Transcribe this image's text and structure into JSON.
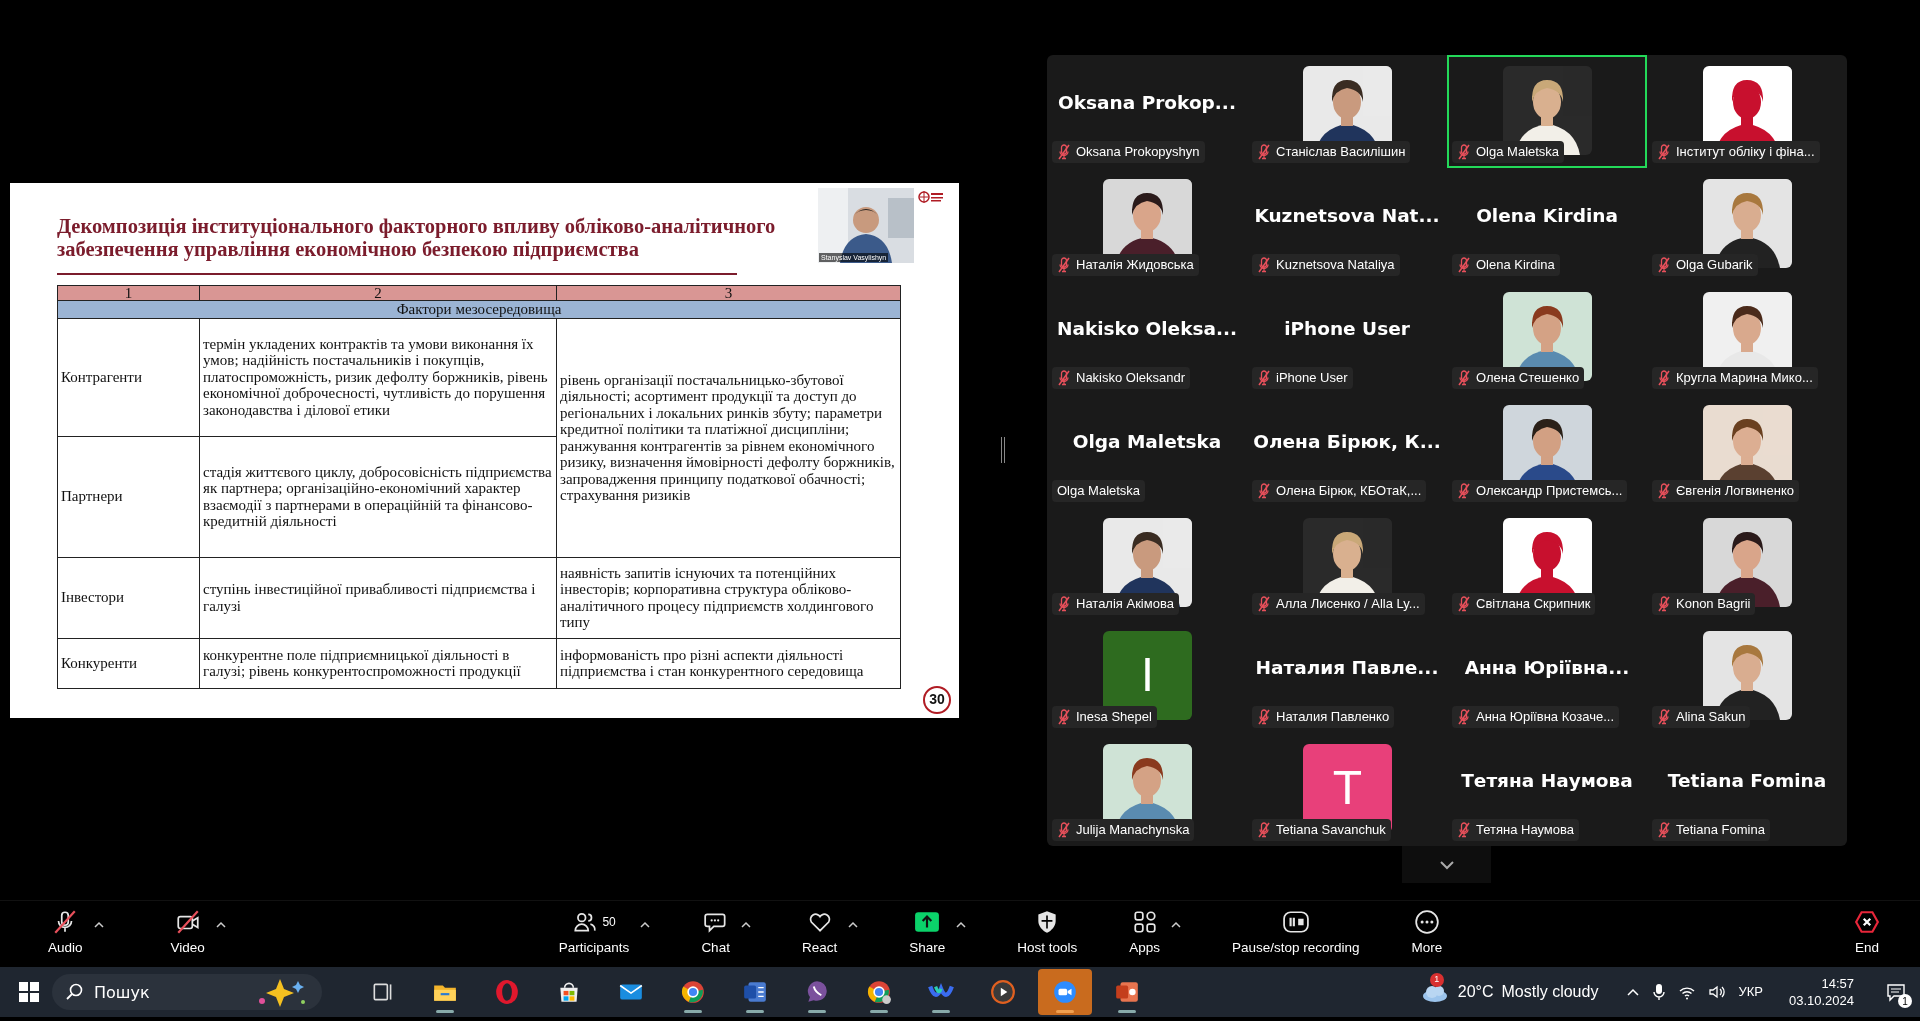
{
  "slide": {
    "title_lines": [
      "Декомпозиція інституціонального факторного впливу обліково-аналітичного",
      "забезпечення управління економічною безпекою підприємства"
    ],
    "presenter_video": {
      "name": "Stanyslav Vasylishyn"
    },
    "columns": [
      "1",
      "2",
      "3"
    ],
    "section": "Фактори мезосередовища",
    "groups": [
      {
        "indicators": "рівень організації постачальницько-збутової діяльності; асортимент продукції та доступ до регіональних і локальних ринків збуту; параметри кредитної політики та платіжної дисципліни; ранжування контрагентів за рівнем економічного ризику, визначення ймовірності дефолту боржників, запровадження принципу податкової обачності; страхування ризиків",
        "rows": [
          {
            "factor": "Контрагенти",
            "description": "термін укладених контрактів та умови виконання їх умов; надійність постачальників і покупців, платоспроможність, ризик дефолту боржників, рівень економічної доброчесності, чутливість до порушення законодавства і ділової етики"
          },
          {
            "factor": "Партнери",
            "description": "стадія життєвого циклу, добросовісність підприємства як партнера; організаційно-економічний характер взаємодії з партнерами в операційній та фінансово-кредитній діяльності"
          }
        ]
      },
      {
        "indicators": "наявність запитів існуючих та потенційних інвесторів; корпоративна структура обліково-аналітичного процесу підприємств холдингового типу",
        "rows": [
          {
            "factor": "Інвестори",
            "description": "ступінь інвестиційної привабливості підприємства і галузі"
          }
        ]
      },
      {
        "indicators": "інформованість про різні аспекти діяльності підприємства і стан конкурентного середовища",
        "rows": [
          {
            "factor": "Конкуренти",
            "description": "конкурентне поле підприємницької діяльності в галузі; рівень конкурентоспроможності продукції"
          }
        ]
      }
    ],
    "page_number": "30"
  },
  "gallery": {
    "tiles": [
      {
        "kind": "name",
        "display_name": "Oksana  Prokop...",
        "label": "Oksana Prokopyshyn",
        "muted": true,
        "speaking": false
      },
      {
        "kind": "picture",
        "label": "Станіслав Василішин",
        "muted": true,
        "speaking": false
      },
      {
        "kind": "picture",
        "label": "Olga Maletska",
        "muted": true,
        "speaking": true
      },
      {
        "kind": "picture",
        "label": "Інститут обліку і фіна...",
        "muted": true,
        "speaking": false
      },
      {
        "kind": "picture",
        "label": "Наталія Жидовська",
        "muted": true,
        "speaking": false
      },
      {
        "kind": "name",
        "display_name": "Kuznetsova  Nat...",
        "label": "Kuznetsova Nataliya",
        "muted": true,
        "speaking": false
      },
      {
        "kind": "name",
        "display_name": "Olena Kirdina",
        "label": "Olena Kirdina",
        "muted": true,
        "speaking": false
      },
      {
        "kind": "picture",
        "label": "Olga Gubarik",
        "muted": true,
        "speaking": false
      },
      {
        "kind": "name",
        "display_name": "Nakisko  Oleksa...",
        "label": "Nakisko Oleksandr",
        "muted": true,
        "speaking": false
      },
      {
        "kind": "name",
        "display_name": "iPhone User",
        "label": "iPhone User",
        "muted": true,
        "speaking": false
      },
      {
        "kind": "picture",
        "label": "Олена Стешенко",
        "muted": true,
        "speaking": false
      },
      {
        "kind": "picture",
        "label": "Кругла Марина Мико...",
        "muted": true,
        "speaking": false
      },
      {
        "kind": "name",
        "display_name": "Olga Maletska",
        "label": "Olga Maletska",
        "muted": false,
        "speaking": false
      },
      {
        "kind": "name",
        "display_name": "Олена  Бірюк, К...",
        "label": "Олена Бірюк, КБОтаК,...",
        "muted": true,
        "speaking": false
      },
      {
        "kind": "picture",
        "label": "Олександр Пристемсь...",
        "muted": true,
        "speaking": false
      },
      {
        "kind": "picture",
        "label": "Євгенія Логвиненко",
        "muted": true,
        "speaking": false
      },
      {
        "kind": "picture",
        "label": "Наталія Акімова",
        "muted": true,
        "speaking": false
      },
      {
        "kind": "picture",
        "label": "Алла Лисенко / Alla Ly...",
        "muted": true,
        "speaking": false
      },
      {
        "kind": "picture",
        "label": "Світлана Скрипник",
        "muted": true,
        "speaking": false
      },
      {
        "kind": "picture",
        "label": "Konon Bagrii",
        "muted": true,
        "speaking": false
      },
      {
        "kind": "initial",
        "initial": "I",
        "color": "#2e6b1f",
        "label": "Inesa Shepel",
        "muted": true,
        "speaking": false
      },
      {
        "kind": "name",
        "display_name": "Наталия  Павле...",
        "label": "Наталия Павленко",
        "muted": true,
        "speaking": false
      },
      {
        "kind": "name",
        "display_name": "Анна  Юріївна...",
        "label": "Анна Юріївна Козаче...",
        "muted": true,
        "speaking": false
      },
      {
        "kind": "picture",
        "label": "Alina Sakun",
        "muted": true,
        "speaking": false
      },
      {
        "kind": "picture",
        "label": "Julija Manachynska",
        "muted": true,
        "speaking": false
      },
      {
        "kind": "initial",
        "initial": "T",
        "color": "#e8407a",
        "label": "Tetiana Savanchuk",
        "muted": true,
        "speaking": false
      },
      {
        "kind": "name",
        "display_name": "Тетяна Наумова",
        "label": "Тетяна Наумова",
        "muted": true,
        "speaking": false
      },
      {
        "kind": "name",
        "display_name": "Tetiana Fomina",
        "label": "Tetiana Fomina",
        "muted": true,
        "speaking": false
      }
    ]
  },
  "toolbar": {
    "items": [
      {
        "label": "Audio",
        "muted": true,
        "menu": true
      },
      {
        "label": "Video",
        "muted": true,
        "menu": true
      },
      {
        "label": "Participants",
        "count": "50",
        "muted": false,
        "menu": true
      },
      {
        "label": "Chat",
        "muted": false,
        "menu": true
      },
      {
        "label": "React",
        "muted": false,
        "menu": true
      },
      {
        "label": "Share",
        "muted": false,
        "menu": true
      },
      {
        "label": "Host tools",
        "muted": false
      },
      {
        "label": "Apps",
        "muted": false,
        "menu": true
      },
      {
        "label": "Pause/stop recording",
        "muted": false
      },
      {
        "label": "More",
        "muted": false
      }
    ],
    "end_label": "End"
  },
  "taskbar": {
    "search_placeholder": "Пошук",
    "apps": [
      {
        "running": false,
        "active": false
      },
      {
        "running": true,
        "active": false
      },
      {
        "running": false,
        "active": false
      },
      {
        "running": false,
        "active": false
      },
      {
        "running": false,
        "active": false
      },
      {
        "running": true,
        "active": false
      },
      {
        "running": true,
        "active": false
      },
      {
        "running": true,
        "active": false
      },
      {
        "running": true,
        "active": false
      },
      {
        "running": true,
        "active": false
      },
      {
        "running": false,
        "active": false
      },
      {
        "running": true,
        "active": true
      },
      {
        "running": true,
        "active": false
      }
    ],
    "weather": {
      "badge": "1",
      "temperature": "20°C",
      "condition": "Mostly cloudy"
    },
    "language": "УКР",
    "time": "14:57",
    "date": "03.10.2024",
    "notifications": "1"
  }
}
